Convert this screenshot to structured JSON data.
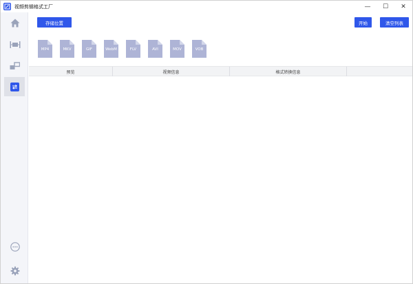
{
  "window": {
    "title": "视频剪辑格式工厂",
    "controls": {
      "minimize": "—",
      "maximize": "☐",
      "close": "✕"
    }
  },
  "sidebar": {
    "items": [
      {
        "icon": "home-icon",
        "active": false
      },
      {
        "icon": "video-trim-icon",
        "active": false
      },
      {
        "icon": "merge-icon",
        "active": false
      },
      {
        "icon": "format-convert-icon",
        "active": true
      },
      {
        "icon": "more-icon",
        "active": false
      },
      {
        "icon": "gear-icon",
        "active": false
      }
    ]
  },
  "toolbar": {
    "save_location_label": "存储位置",
    "start_label": "开始",
    "clear_list_label": "清空列表"
  },
  "formats": [
    "MP4",
    "MKV",
    "GIF",
    "WebM",
    "FLV",
    "AVI",
    "MOV",
    "VOB"
  ],
  "table": {
    "columns": [
      "预览",
      "视频信息",
      "格式转换信息"
    ]
  },
  "colors": {
    "accent": "#2f57ea",
    "format_icon": "#aeb4d6",
    "sidebar_bg": "#f4f5f9"
  }
}
